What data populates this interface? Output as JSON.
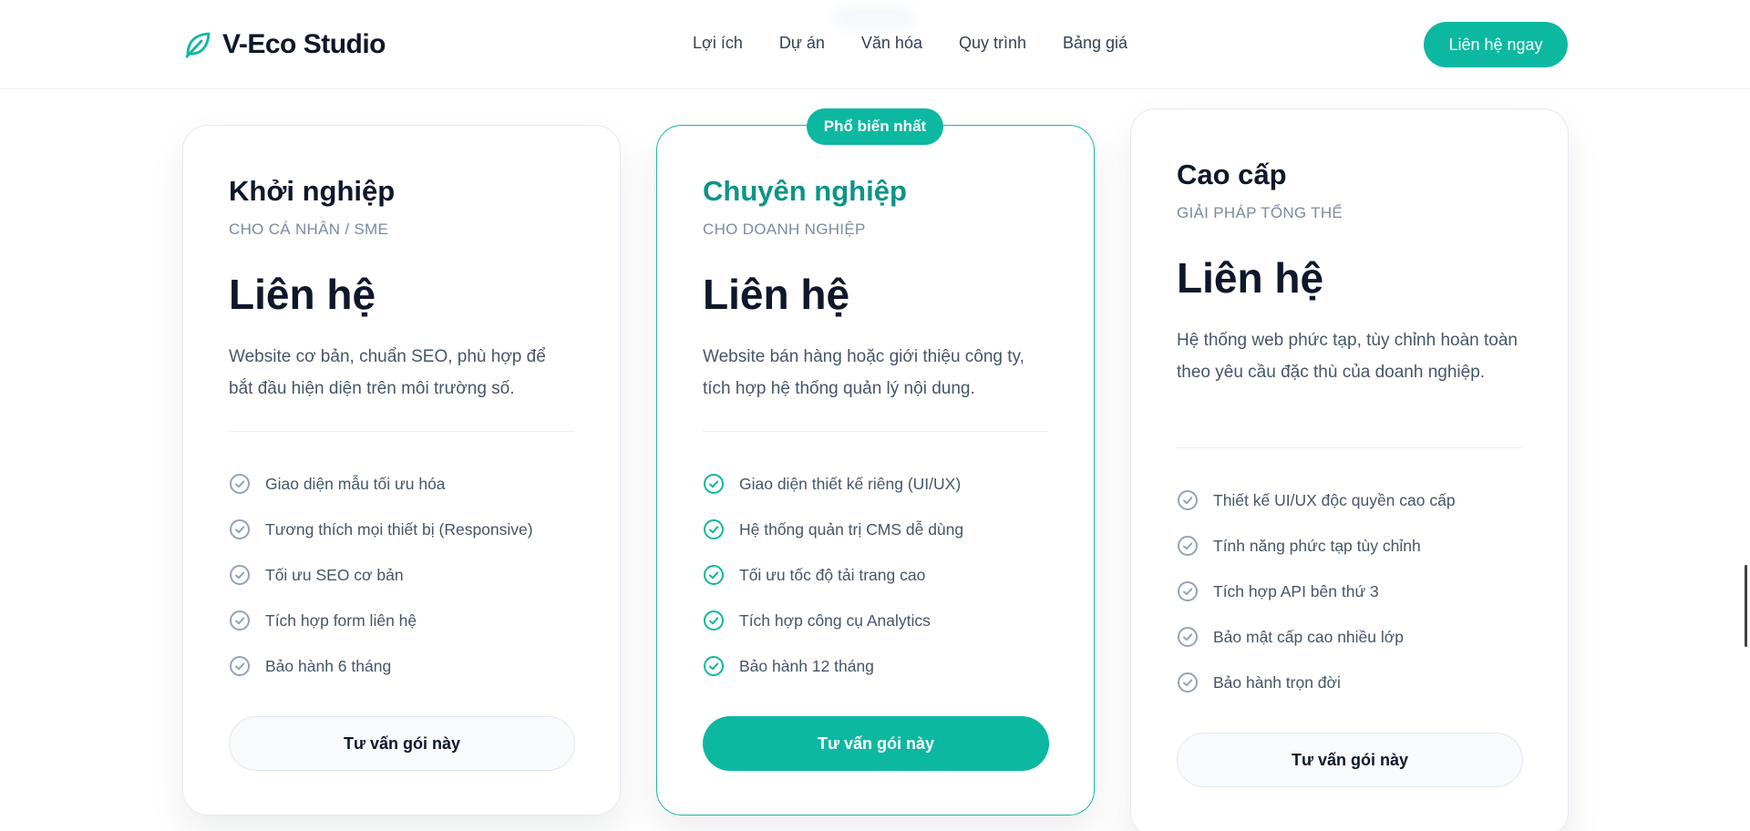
{
  "header": {
    "logo_text": "V-Eco Studio",
    "nav": [
      "Lợi ích",
      "Dự án",
      "Văn hóa",
      "Quy trình",
      "Bảng giá"
    ],
    "cta_label": "Liên hệ ngay"
  },
  "badge": "Phổ biến nhất",
  "plans": [
    {
      "name": "Khởi nghiệp",
      "subtitle": "CHO CÁ NHÂN / SME",
      "price": "Liên hệ",
      "description": "Website cơ bản, chuẩn SEO, phù hợp để bắt đầu hiện diện trên môi trường số.",
      "features": [
        "Giao diện mẫu tối ưu hóa",
        "Tương thích mọi thiết bị (Responsive)",
        "Tối ưu SEO cơ bản",
        "Tích hợp form liên hệ",
        "Bảo hành 6 tháng"
      ],
      "button": "Tư vấn gói này"
    },
    {
      "name": "Chuyên nghiệp",
      "subtitle": "CHO DOANH NGHIỆP",
      "price": "Liên hệ",
      "description": "Website bán hàng hoặc giới thiệu công ty, tích hợp hệ thống quản lý nội dung.",
      "features": [
        "Giao diện thiết kế riêng (UI/UX)",
        "Hệ thống quản trị CMS dễ dùng",
        "Tối ưu tốc độ tải trang cao",
        "Tích hợp công cụ Analytics",
        "Bảo hành 12 tháng"
      ],
      "button": "Tư vấn gói này"
    },
    {
      "name": "Cao cấp",
      "subtitle": "GIẢI PHÁP TỔNG THỂ",
      "price": "Liên hệ",
      "description": "Hệ thống web phức tạp, tùy chỉnh hoàn toàn theo yêu cầu đặc thù của doanh nghiệp.",
      "features": [
        "Thiết kế UI/UX độc quyền cao cấp",
        "Tính năng phức tạp tùy chỉnh",
        "Tích hợp API bên thứ 3",
        "Bảo mật cấp cao nhiều lớp",
        "Bảo hành trọn đời"
      ],
      "button": "Tư vấn gói này"
    }
  ],
  "colors": {
    "accent": "#0db8a1",
    "accent_dark": "#0d9488",
    "check_muted": "#94a3b8"
  }
}
